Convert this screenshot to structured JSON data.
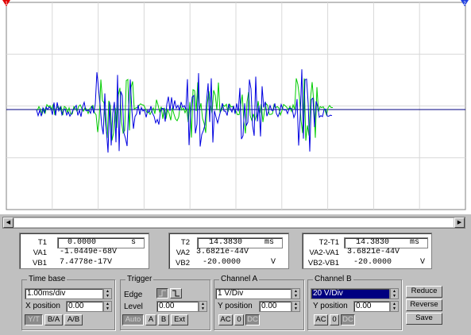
{
  "markers": {
    "left": "1",
    "right": "2"
  },
  "colors": {
    "trace_a": "#0000e0",
    "trace_b": "#00cc00",
    "baseline": "#000080",
    "grid": "#808080"
  },
  "readouts": [
    {
      "label_t": "T1",
      "t_value": "0.0000",
      "t_unit": "s",
      "label_a": "VA1",
      "a_value": "-1.0449e-68V",
      "label_b": "VB1",
      "b_value": "7.4778e-17V"
    },
    {
      "label_t": "T2",
      "t_value": "14.3830",
      "t_unit": "ms",
      "label_a": "VA2",
      "a_value": "3.6821e-44V",
      "label_b": "VB2",
      "b_value": "-20.0000",
      "b_unit": "V"
    },
    {
      "label_t": "T2-T1",
      "t_value": "14.3830",
      "t_unit": "ms",
      "label_a": "VA2-VA1",
      "a_value": "3.6821e-44V",
      "label_b": "VB2-VB1",
      "b_value": "-20.0000",
      "b_unit": "V"
    }
  ],
  "timebase": {
    "title": "Time base",
    "scale": "1.00ms/div",
    "xpos_label": "X position",
    "xpos": "0.00",
    "buttons": [
      "Y/T",
      "B/A",
      "A/B"
    ]
  },
  "trigger": {
    "title": "Trigger",
    "edge_label": "Edge",
    "level_label": "Level",
    "level": "0.00",
    "buttons": [
      "Auto",
      "A",
      "B",
      "Ext"
    ]
  },
  "channel_a": {
    "title": "Channel A",
    "scale": "1  V/Div",
    "ypos_label": "Y position",
    "ypos": "0.00",
    "buttons": [
      "AC",
      "0",
      "DC"
    ]
  },
  "channel_b": {
    "title": "Channel B",
    "scale": "20  V/Div",
    "ypos_label": "Y position",
    "ypos": "0.00",
    "buttons": [
      "AC",
      "0",
      "DC"
    ]
  },
  "actions": [
    "Reduce",
    "Reverse",
    "Save"
  ]
}
